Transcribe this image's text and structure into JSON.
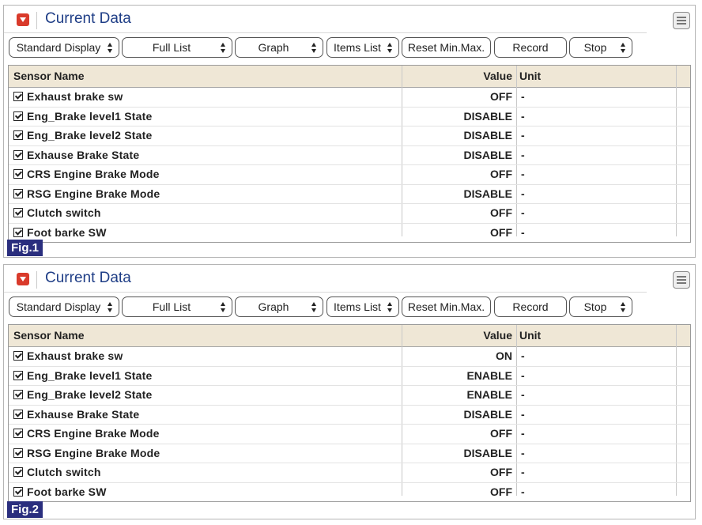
{
  "panels": [
    {
      "title": "Current Data",
      "figure_label": "Fig.1",
      "toolbar": {
        "standard_display": "Standard Display",
        "full_list": "Full List",
        "graph": "Graph",
        "items_list": "Items List",
        "reset": "Reset Min.Max.",
        "record": "Record",
        "stop": "Stop"
      },
      "columns": {
        "name": "Sensor Name",
        "value": "Value",
        "unit": "Unit"
      },
      "rows": [
        {
          "name": "Exhaust brake sw",
          "value": "OFF",
          "unit": "-"
        },
        {
          "name": "Eng_Brake level1 State",
          "value": "DISABLE",
          "unit": "-"
        },
        {
          "name": "Eng_Brake level2 State",
          "value": "DISABLE",
          "unit": "-"
        },
        {
          "name": "Exhause Brake State",
          "value": "DISABLE",
          "unit": "-"
        },
        {
          "name": "CRS Engine Brake Mode",
          "value": "OFF",
          "unit": "-"
        },
        {
          "name": "RSG Engine Brake Mode",
          "value": "DISABLE",
          "unit": "-"
        },
        {
          "name": "Clutch switch",
          "value": "OFF",
          "unit": "-"
        },
        {
          "name": "Foot barke SW",
          "value": "OFF",
          "unit": "-"
        }
      ]
    },
    {
      "title": "Current Data",
      "figure_label": "Fig.2",
      "toolbar": {
        "standard_display": "Standard Display",
        "full_list": "Full List",
        "graph": "Graph",
        "items_list": "Items List",
        "reset": "Reset Min.Max.",
        "record": "Record",
        "stop": "Stop"
      },
      "columns": {
        "name": "Sensor Name",
        "value": "Value",
        "unit": "Unit"
      },
      "rows": [
        {
          "name": "Exhaust brake sw",
          "value": "ON",
          "unit": "-"
        },
        {
          "name": "Eng_Brake level1 State",
          "value": "ENABLE",
          "unit": "-"
        },
        {
          "name": "Eng_Brake level2 State",
          "value": "ENABLE",
          "unit": "-"
        },
        {
          "name": "Exhause Brake State",
          "value": "DISABLE",
          "unit": "-"
        },
        {
          "name": "CRS Engine Brake Mode",
          "value": "OFF",
          "unit": "-"
        },
        {
          "name": "RSG Engine Brake Mode",
          "value": "DISABLE",
          "unit": "-"
        },
        {
          "name": "Clutch switch",
          "value": "OFF",
          "unit": "-"
        },
        {
          "name": "Foot barke SW",
          "value": "OFF",
          "unit": "-"
        }
      ]
    }
  ],
  "icons": {
    "collapse": "collapse-arrow-icon",
    "menu": "menu-icon",
    "checkbox": "checkbox-checked-icon",
    "spin": "spin-arrows-icon"
  },
  "colors": {
    "title": "#1e3d86",
    "collapse_icon": "#d93a2b",
    "header_bg": "#efe7d6",
    "figure_label_bg": "#2a2e7e"
  }
}
